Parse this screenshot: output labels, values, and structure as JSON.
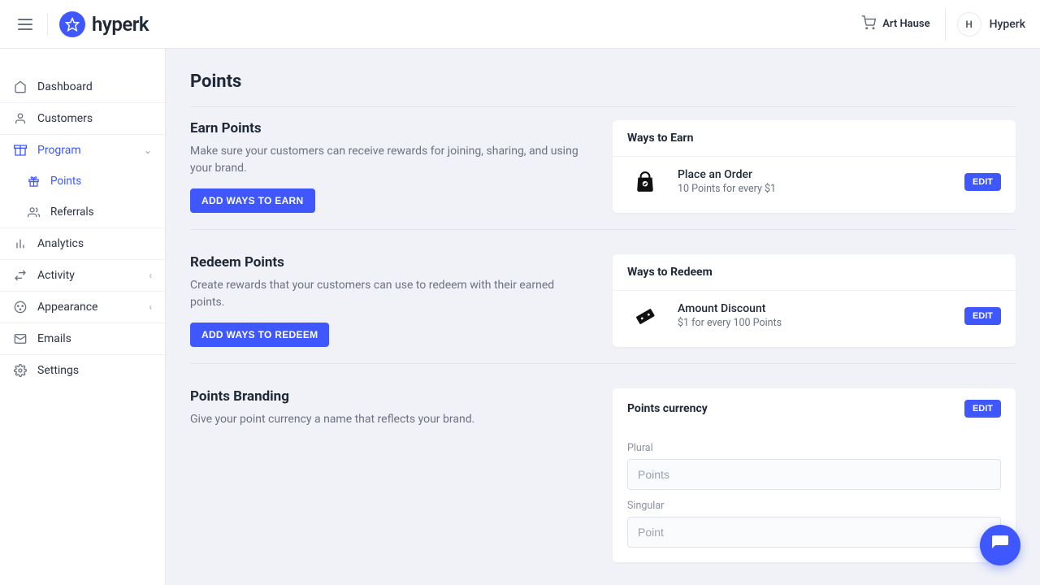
{
  "brand": {
    "name": "hyperk"
  },
  "header": {
    "store_label": "Art Hause",
    "avatar_initial": "H",
    "avatar_name": "Hyperk"
  },
  "sidebar": {
    "dashboard": "Dashboard",
    "customers": "Customers",
    "program": "Program",
    "points": "Points",
    "referrals": "Referrals",
    "analytics": "Analytics",
    "activity": "Activity",
    "appearance": "Appearance",
    "emails": "Emails",
    "settings": "Settings"
  },
  "page": {
    "title": "Points"
  },
  "earn": {
    "title": "Earn Points",
    "desc": "Make sure your customers can receive rewards for joining, sharing, and using your brand.",
    "button": "ADD WAYS TO EARN",
    "card_title": "Ways to Earn",
    "item_title": "Place an Order",
    "item_sub": "10 Points for every $1",
    "edit": "EDIT"
  },
  "redeem": {
    "title": "Redeem Points",
    "desc": "Create rewards that your customers can use to redeem with their earned points.",
    "button": "ADD WAYS TO REDEEM",
    "card_title": "Ways to Redeem",
    "item_title": "Amount Discount",
    "item_sub": "$1 for every 100 Points",
    "edit": "EDIT"
  },
  "branding": {
    "title": "Points Branding",
    "desc": "Give your point currency a name that reflects your brand.",
    "card_title": "Points currency",
    "edit": "EDIT",
    "plural_label": "Plural",
    "plural_placeholder": "Points",
    "singular_label": "Singular",
    "singular_placeholder": "Point"
  }
}
